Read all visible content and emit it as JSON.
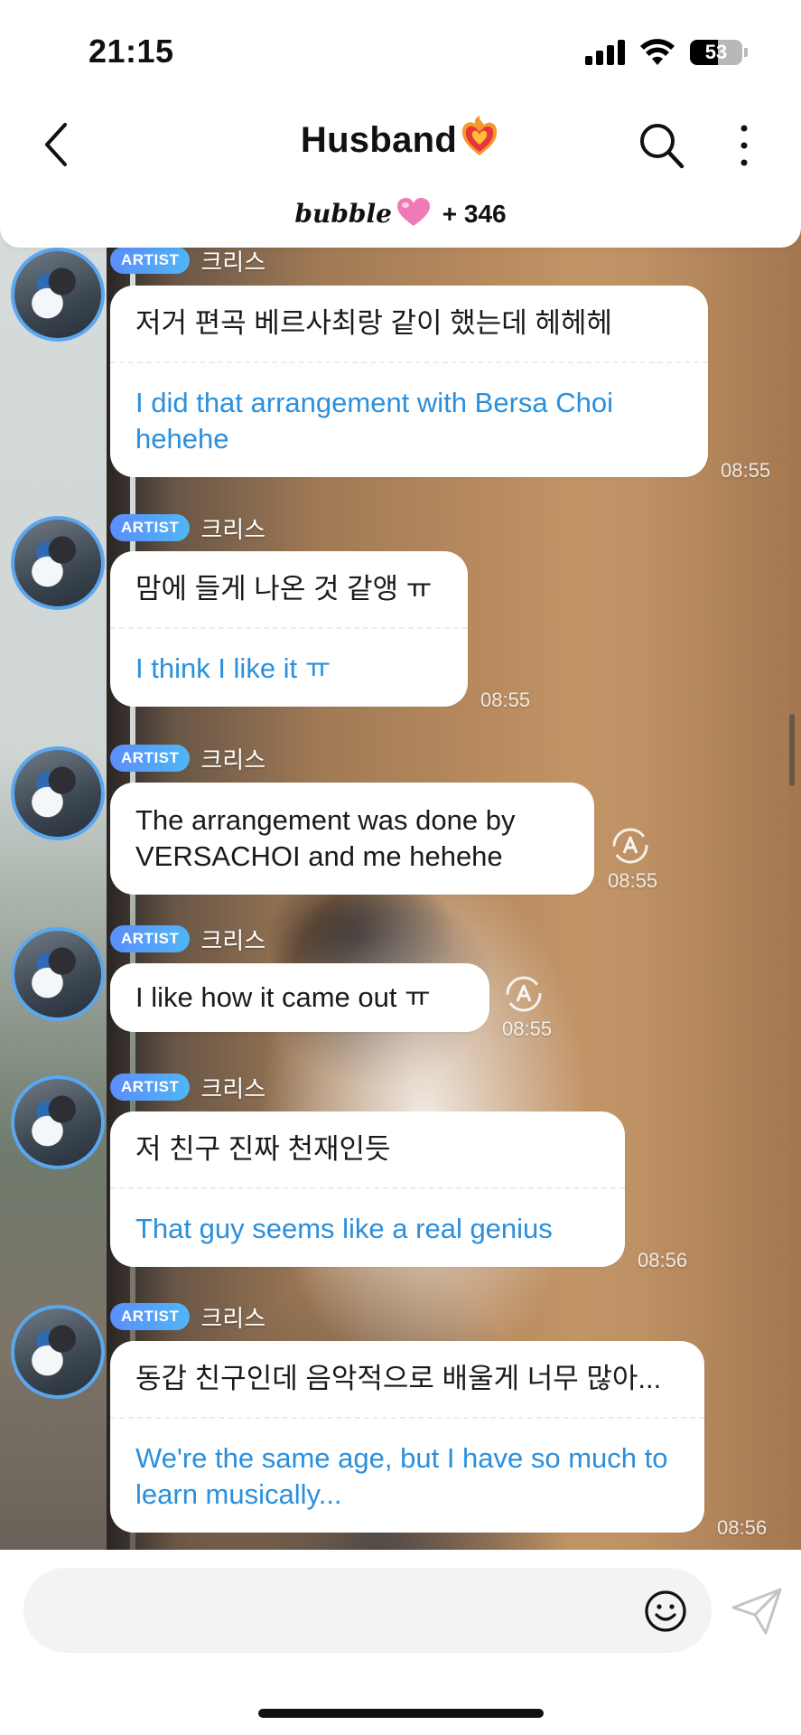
{
  "status_bar": {
    "time": "21:15",
    "battery_percent": "53"
  },
  "header": {
    "title": "Husband",
    "title_emoji": "heart-on-fire",
    "brand": "bubble",
    "member_count": "+ 346"
  },
  "messages": [
    {
      "badge": "ARTIST",
      "sender": "크리스",
      "original": "저거 편곡 베르사최랑 같이 했는데 헤헤헤",
      "translation": "I did that arrangement with Bersa Choi hehehe",
      "time": "08:55"
    },
    {
      "badge": "ARTIST",
      "sender": "크리스",
      "original": "맘에 들게 나온 것 같앵 ㅠ",
      "translation": "I think I like it ㅠ",
      "time": "08:55"
    },
    {
      "badge": "ARTIST",
      "sender": "크리스",
      "original": "The arrangement was done by VERSACHOI and me hehehe",
      "time": "08:55",
      "translate_icon": "auto-translate-icon"
    },
    {
      "badge": "ARTIST",
      "sender": "크리스",
      "original": "I like how it came out ㅠ",
      "time": "08:55",
      "translate_icon": "auto-translate-icon"
    },
    {
      "badge": "ARTIST",
      "sender": "크리스",
      "original": "저 친구 진짜 천재인듯",
      "translation": "That guy seems like a real genius",
      "time": "08:56"
    },
    {
      "badge": "ARTIST",
      "sender": "크리스",
      "original": "동갑 친구인데 음악적으로 배울게 너무 많아...",
      "translation": "We're the same age, but I have so much to learn musically...",
      "time": "08:56"
    }
  ],
  "input": {
    "value": "",
    "placeholder": ""
  },
  "colors": {
    "accent_blue": "#2a8fdc",
    "badge_gradient_start": "#5c8dfc",
    "badge_gradient_end": "#4fb6f5",
    "avatar_ring": "#5aa7f0",
    "pink_heart": "#f07ab5"
  }
}
